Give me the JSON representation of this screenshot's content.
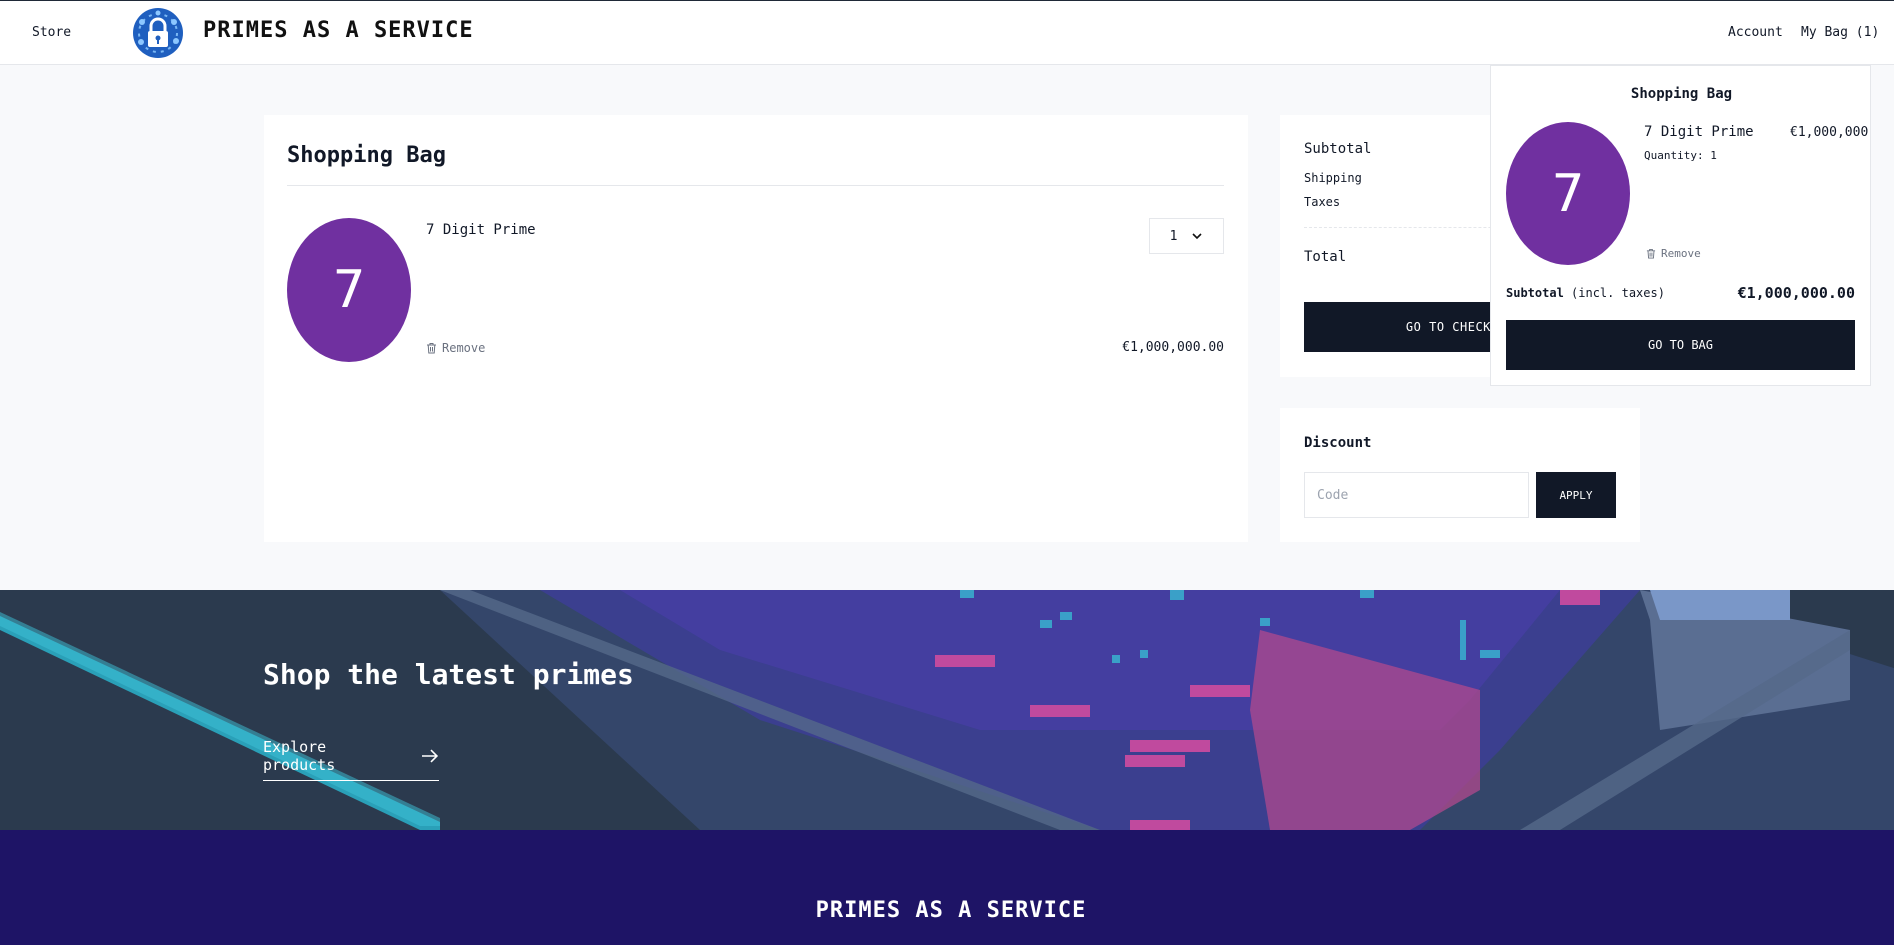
{
  "header": {
    "store_label": "Store",
    "brand_name": "PRIMES AS A SERVICE",
    "account_label": "Account",
    "bag_label": "My Bag (1)"
  },
  "bag": {
    "title": "Shopping Bag",
    "item": {
      "thumb_text": "7",
      "name": "7 Digit Prime",
      "quantity": "1",
      "remove_label": "Remove",
      "price": "€1,000,000.00"
    }
  },
  "summary": {
    "subtotal_label": "Subtotal",
    "shipping_label": "Shipping",
    "taxes_label": "Taxes",
    "total_label": "Total",
    "checkout_label": "GO TO CHECKOUT"
  },
  "discount": {
    "title": "Discount",
    "placeholder": "Code",
    "apply_label": "APPLY"
  },
  "popover": {
    "title": "Shopping Bag",
    "thumb_text": "7",
    "item_name": "7 Digit Prime",
    "item_price": "€1,000,000",
    "quantity_text": "Quantity: 1",
    "remove_label": "Remove",
    "subtotal_label": "Subtotal",
    "subtotal_note": "(incl. taxes)",
    "subtotal_value": "€1,000,000.00",
    "go_bag_label": "GO TO BAG"
  },
  "hero": {
    "title": "Shop the latest primes",
    "link_label": "Explore products"
  },
  "footer": {
    "brand_name": "PRIMES AS A SERVICE"
  },
  "colors": {
    "dark_button": "#111827",
    "product_purple": "#7030a0",
    "footer_indigo": "#1e1466",
    "hero_slate": "#2b3a4e",
    "logo_blue": "#1f5fbf"
  },
  "icons": [
    "lock-logo-icon",
    "chevron-down-icon",
    "trash-icon",
    "arrow-right-icon"
  ]
}
